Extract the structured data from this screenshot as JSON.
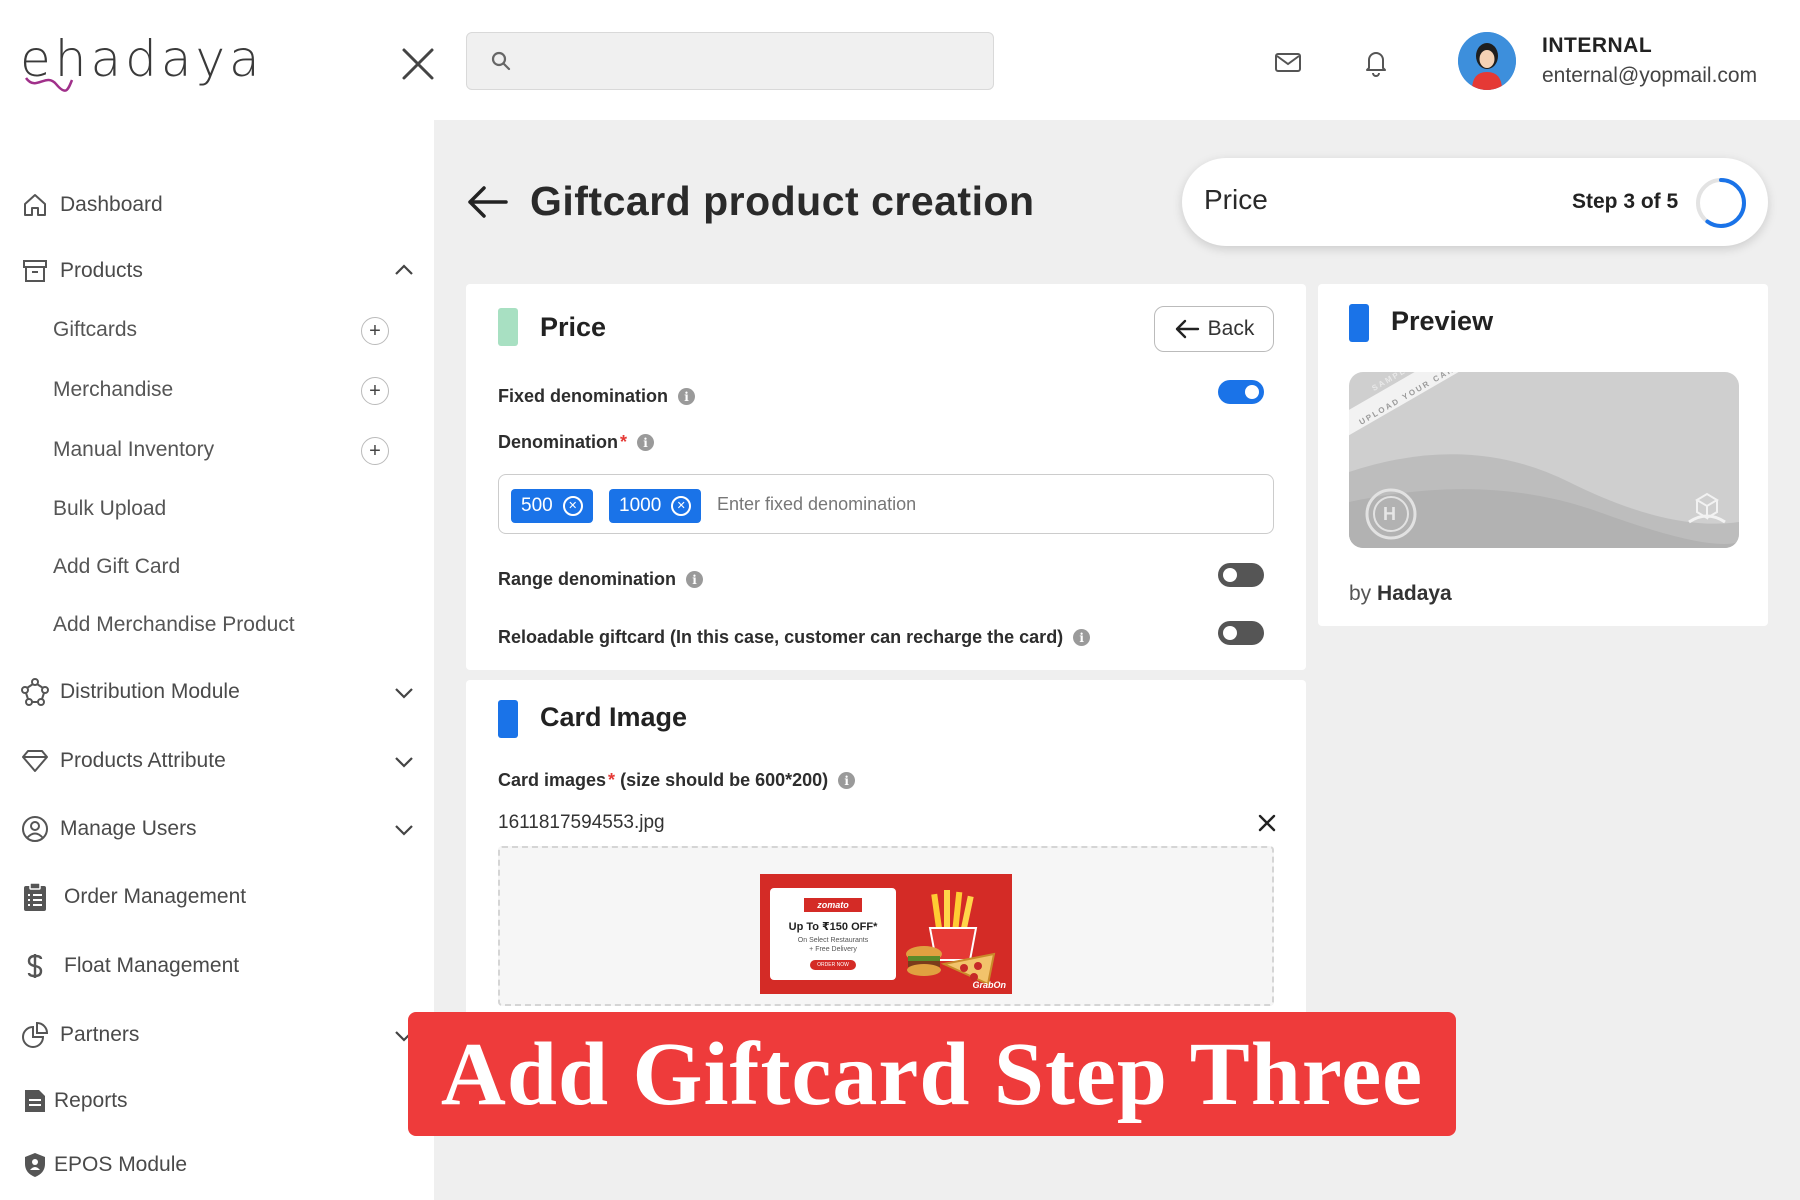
{
  "app": {
    "logo_text": "ehadaya"
  },
  "header": {
    "search": {
      "placeholder": "",
      "value": ""
    },
    "icons": [
      "mail-icon",
      "bell-icon"
    ],
    "user": {
      "name": "INTERNAL",
      "email": "enternal@yopmail.com"
    }
  },
  "sidebar": {
    "dashboard": "Dashboard",
    "products": "Products",
    "product_items": [
      "Giftcards",
      "Merchandise",
      "Manual Inventory",
      "Bulk Upload",
      "Add Gift Card",
      "Add Merchandise Product"
    ],
    "distribution": "Distribution Module",
    "attribute": "Products Attribute",
    "users": "Manage Users",
    "orders": "Order Management",
    "float": "Float Management",
    "partners": "Partners",
    "reports": "Reports",
    "epos": "EPOS Module"
  },
  "page": {
    "title": "Giftcard product creation",
    "step_label": "Price",
    "step_text": "Step 3 of 5",
    "step_progress": 0.6
  },
  "price_section": {
    "title": "Price",
    "back_label": "Back",
    "fixed_label": "Fixed denomination",
    "fixed_on": true,
    "denomination_label": "Denomination",
    "chips": [
      "500",
      "1000"
    ],
    "denomination_placeholder": "Enter fixed denomination",
    "range_label": "Range denomination",
    "range_on": false,
    "reloadable_label": "Reloadable giftcard (In this case, customer can recharge the card)",
    "reloadable_on": false
  },
  "card_image_section": {
    "title": "Card Image",
    "label": "Card images",
    "label_note": "(size should be 600*200)",
    "file_name": "1611817594553.jpg",
    "image": {
      "brand": "zomato",
      "offer": "Up To ₹150 OFF*",
      "sub1": "On Select Restaurants",
      "sub2": "+ Free Delivery",
      "cta": "ORDER NOW",
      "partner": "GrabOn"
    }
  },
  "preview_section": {
    "title": "Preview",
    "card_watermark": "SAMPLE",
    "card_upload_text": "UPLOAD YOUR CARD",
    "card_logo_letter": "H",
    "by_prefix": "by",
    "by_brand": "Hadaya"
  },
  "banner": {
    "text": "Add Giftcard Step Three"
  },
  "colors": {
    "accent": "#1a73e8",
    "price_bar": "#a8e0c2",
    "banner": "#ee3b3b",
    "background": "#efefef"
  }
}
